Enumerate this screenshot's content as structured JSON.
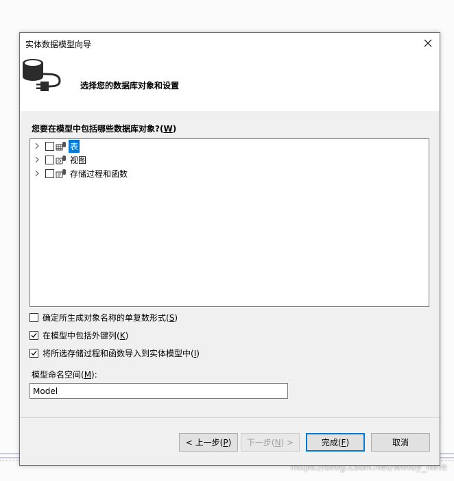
{
  "dialog": {
    "title": "实体数据模型向导",
    "header_text": "选择您的数据库对象和设置"
  },
  "tree": {
    "prompt_prefix": "您要在模型中包括哪些数据库对象?(",
    "prompt_key": "W",
    "prompt_suffix": ")",
    "items": [
      {
        "label": "表",
        "selected": true
      },
      {
        "label": "视图",
        "selected": false
      },
      {
        "label": "存储过程和函数",
        "selected": false
      }
    ]
  },
  "options": [
    {
      "prefix": "确定所生成对象名称的单复数形式(",
      "key": "S",
      "suffix": ")",
      "checked": false
    },
    {
      "prefix": "在模型中包括外键列(",
      "key": "K",
      "suffix": ")",
      "checked": true
    },
    {
      "prefix": "将所选存储过程和函数导入到实体模型中(",
      "key": "I",
      "suffix": ")",
      "checked": true
    }
  ],
  "namespace": {
    "label_prefix": "模型命名空间(",
    "label_key": "M",
    "label_suffix": "):",
    "value": "Model"
  },
  "buttons": {
    "back": {
      "prefix": "< 上一步(",
      "key": "P",
      "suffix": ")"
    },
    "next": {
      "prefix": "下一步(",
      "key": "N",
      "suffix": ") >"
    },
    "finish": {
      "prefix": "完成(",
      "key": "F",
      "suffix": ")"
    },
    "cancel": {
      "label": "取消"
    }
  },
  "watermark": "https://blog.csdn.net/windy_nine",
  "colors": {
    "accent": "#0078d7",
    "dialog_bg": "#f0f0f0",
    "header_bg": "#ffffff"
  }
}
